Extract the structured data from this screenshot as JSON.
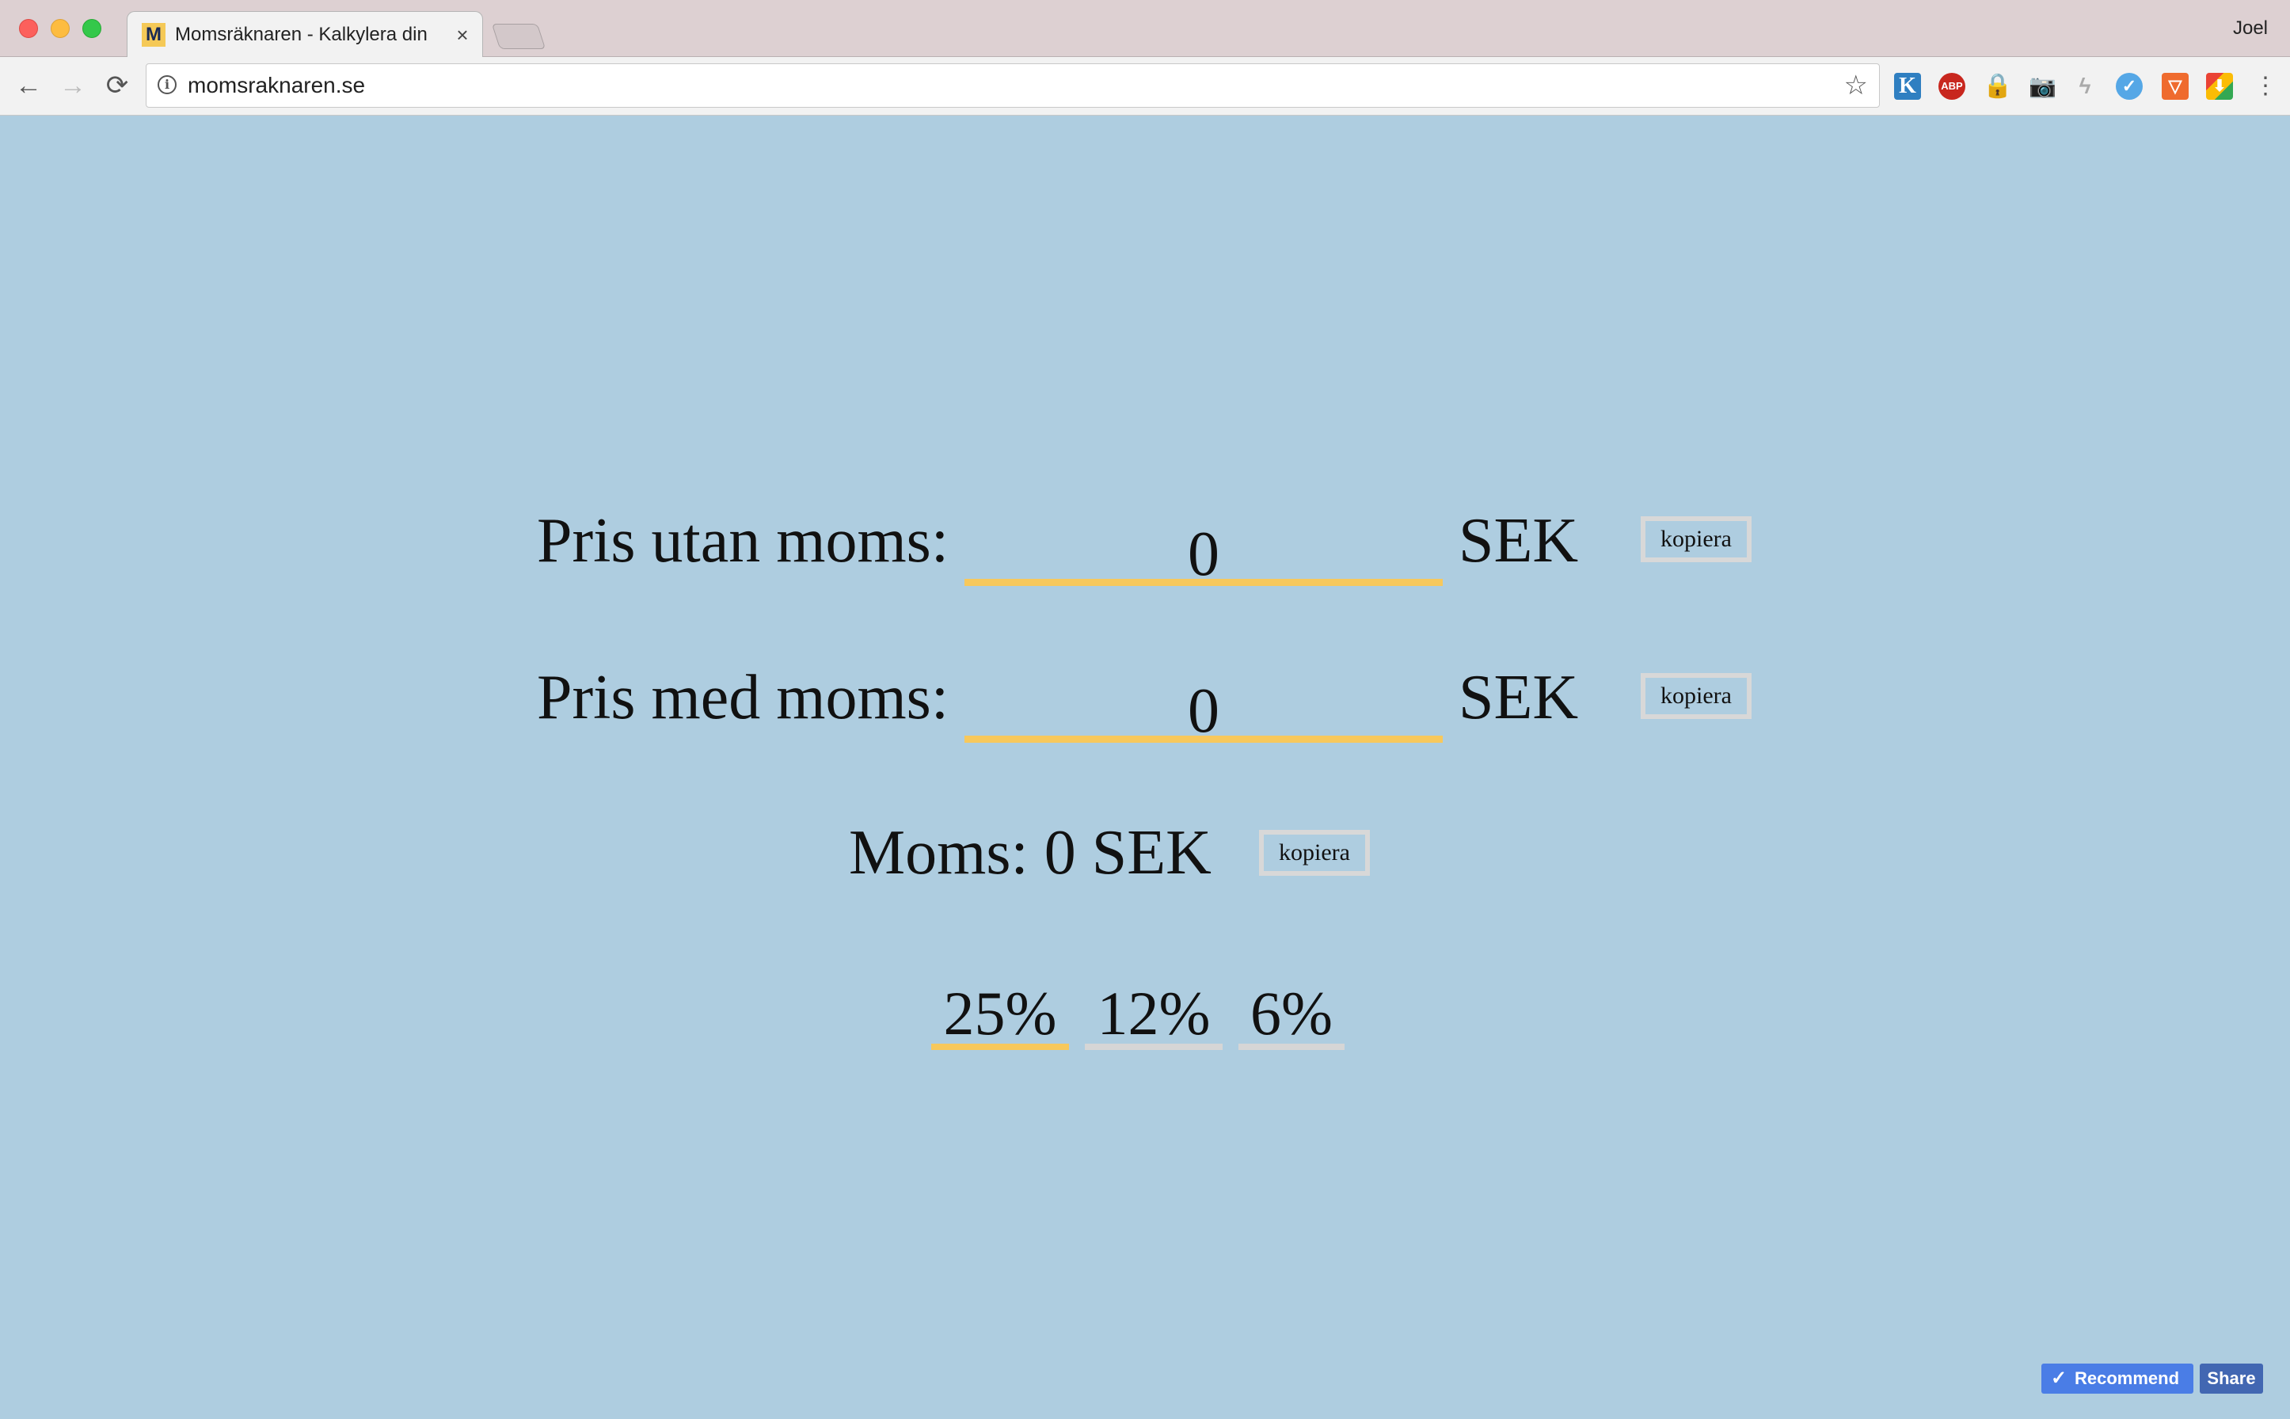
{
  "browser": {
    "tab_favicon": "M",
    "tab_title": "Momsräknaren - Kalkylera din",
    "tab_close": "×",
    "profile_name": "Joel",
    "url": "momsraknaren.se",
    "icons": {
      "back": "←",
      "forward": "→",
      "reload": "⟳",
      "info": "i",
      "star": "☆",
      "menu": "⋮"
    },
    "extensions": {
      "k": "K",
      "abp": "ABP",
      "lock": "🔒",
      "camera": "📷",
      "bolt": "ϟ",
      "check": "✓",
      "pocket": "▽",
      "drive": "⬇"
    }
  },
  "calculator": {
    "price_without_vat": {
      "label": "Pris utan moms:",
      "value": "0",
      "currency": "SEK",
      "copy_label": "kopiera"
    },
    "price_with_vat": {
      "label": "Pris med moms:",
      "value": "0",
      "currency": "SEK",
      "copy_label": "kopiera"
    },
    "vat": {
      "label": "Moms: 0 SEK",
      "copy_label": "kopiera"
    },
    "rates": [
      {
        "label": "25%",
        "active": true
      },
      {
        "label": "12%",
        "active": false
      },
      {
        "label": "6%",
        "active": false
      }
    ]
  },
  "facebook": {
    "recommend_label": "Recommend",
    "recommend_icon": "✓",
    "share_label": "Share"
  },
  "colors": {
    "page_bg": "#aecde0",
    "accent_underline": "#f7c85c",
    "inactive_underline": "#d6d6d6"
  }
}
